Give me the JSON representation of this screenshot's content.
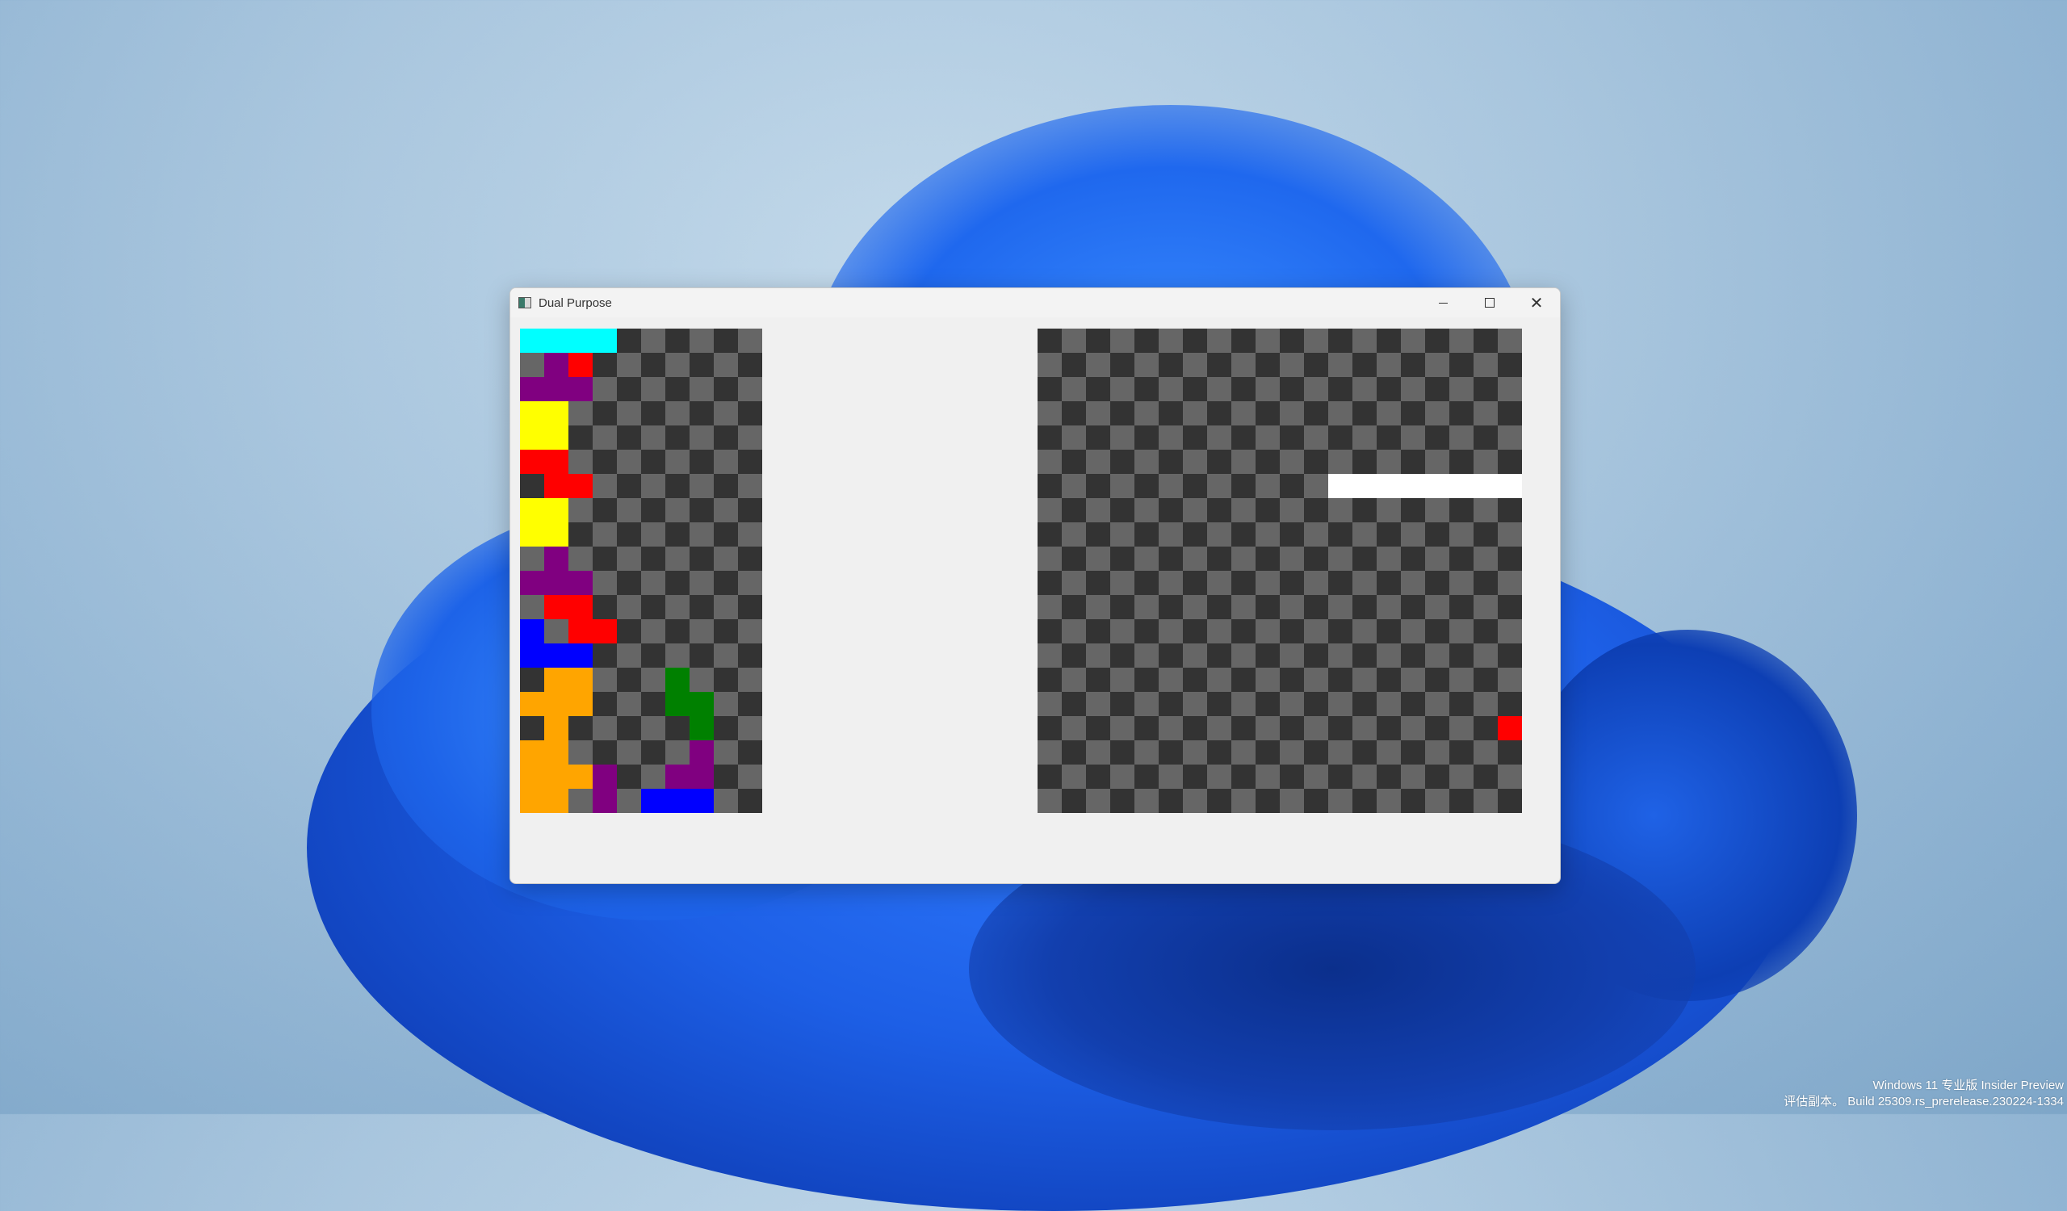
{
  "window": {
    "title": "Dual Purpose"
  },
  "controls": {
    "minimize_icon": "minimize-icon",
    "maximize_icon": "maximize-icon",
    "close_icon": "close-icon"
  },
  "colors": {
    "checker_dark": "#333333",
    "checker_light": "#666666",
    "cyan": "#00ffff",
    "purple": "#800080",
    "red": "#ff0000",
    "yellow": "#ffff00",
    "blue": "#0000ff",
    "orange": "#ffa500",
    "green": "#008000",
    "white": "#ffffff"
  },
  "left_board": {
    "cols": 10,
    "rows": 20,
    "grid": [
      "CCCC......",
      ".PR.......",
      "PPP.......",
      "YY........",
      "YY........",
      "RR........",
      ".RR.......",
      "YY........",
      "YY........",
      ".P........",
      "PPP.......",
      ".RR.......",
      "B.RR......",
      "BBB.......",
      ".OO...G...",
      "OOO...GG..",
      ".O.....G..",
      "OO.....P..",
      "OOOP..PP..",
      "OO.P.BBB.."
    ]
  },
  "right_board": {
    "cols": 20,
    "rows": 20,
    "grid": [
      "....................",
      "....................",
      "....................",
      "....................",
      "....................",
      "....................",
      "............WWWWWWWW",
      "....................",
      "....................",
      "....................",
      "....................",
      "....................",
      "....................",
      "....................",
      "....................",
      "....................",
      "...................R",
      "....................",
      "....................",
      "...................."
    ]
  },
  "watermark": {
    "line1": "Windows 11 专业版 Insider Preview",
    "line2": "评估副本。 Build 25309.rs_prerelease.230224-1334"
  }
}
